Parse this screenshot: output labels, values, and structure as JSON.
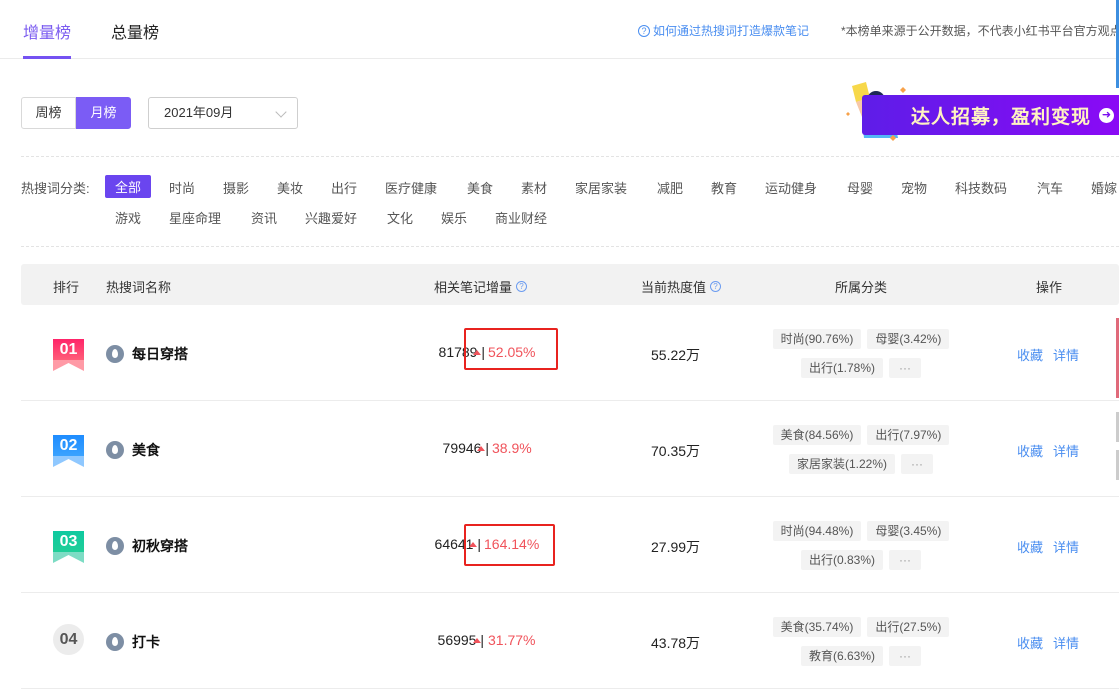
{
  "tabs": [
    {
      "label": "增量榜",
      "active": true
    },
    {
      "label": "总量榜",
      "active": false
    }
  ],
  "help_link": "如何通过热搜词打造爆款笔记",
  "disclaimer": "*本榜单来源于公开数据，不代表小红书平台官方观点",
  "period_toggle": [
    {
      "label": "周榜",
      "active": false
    },
    {
      "label": "月榜",
      "active": true
    }
  ],
  "date_select": {
    "value": "2021年09月"
  },
  "banner": {
    "text": "达人招募，盈利变现",
    "arrow": "➜"
  },
  "categories": {
    "label": "热搜词分类:",
    "items": [
      "全部",
      "时尚",
      "摄影",
      "美妆",
      "出行",
      "医疗健康",
      "美食",
      "素材",
      "家居家装",
      "减肥",
      "教育",
      "运动健身",
      "母婴",
      "宠物",
      "科技数码",
      "汽车",
      "婚嫁",
      "游戏",
      "星座命理",
      "资讯",
      "兴趣爱好",
      "文化",
      "娱乐",
      "商业财经"
    ],
    "active": "全部"
  },
  "table": {
    "headers": {
      "rank": "排行",
      "keyword": "热搜词名称",
      "notes": "相关笔记增量",
      "heat": "当前热度值",
      "category": "所属分类",
      "ops": "操作"
    },
    "rows": [
      {
        "rank": "01",
        "keyword": "每日穿搭",
        "notes": "81789 |",
        "growth": "52.05%",
        "highlighted": true,
        "heat": "55.22万",
        "tags": [
          [
            "时尚(90.76%)",
            "母婴(3.42%)"
          ],
          [
            "出行(1.78%)",
            "···"
          ]
        ],
        "op_fav": "收藏",
        "op_detail": "详情"
      },
      {
        "rank": "02",
        "keyword": "美食",
        "notes": "79946 |",
        "growth": "38.9%",
        "highlighted": false,
        "heat": "70.35万",
        "tags": [
          [
            "美食(84.56%)",
            "出行(7.97%)"
          ],
          [
            "家居家装(1.22%)",
            "···"
          ]
        ],
        "op_fav": "收藏",
        "op_detail": "详情"
      },
      {
        "rank": "03",
        "keyword": "初秋穿搭",
        "notes": "64641 |",
        "growth": "164.14%",
        "highlighted": true,
        "heat": "27.99万",
        "tags": [
          [
            "时尚(94.48%)",
            "母婴(3.45%)"
          ],
          [
            "出行(0.83%)",
            "···"
          ]
        ],
        "op_fav": "收藏",
        "op_detail": "详情"
      },
      {
        "rank": "04",
        "keyword": "打卡",
        "notes": "56995 |",
        "growth": "31.77%",
        "highlighted": false,
        "heat": "43.78万",
        "tags": [
          [
            "美食(35.74%)",
            "出行(27.5%)"
          ],
          [
            "教育(6.63%)",
            "···"
          ]
        ],
        "op_fav": "收藏",
        "op_detail": "详情"
      }
    ]
  },
  "colors": {
    "accent": "#7b5cf5",
    "link": "#4a8ef0",
    "up": "#f0535b",
    "highlight": "#e8231f"
  }
}
